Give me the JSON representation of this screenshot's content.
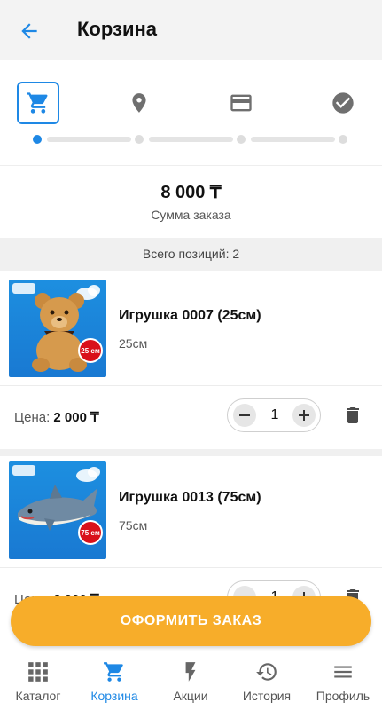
{
  "header": {
    "title": "Корзина"
  },
  "steps": [
    "cart-icon",
    "location-pin-icon",
    "credit-card-icon",
    "check-circle-icon"
  ],
  "total": {
    "amount": "8 000 ₸",
    "caption": "Сумма заказа"
  },
  "count_label": "Всего позиций: 2",
  "items": [
    {
      "name": "Игрушка 0007 (25см)",
      "size": "25см",
      "badge": "25 см",
      "price_label": "Цена:",
      "price": "2 000 ₸",
      "quantity": "1"
    },
    {
      "name": "Игрушка 0013 (75см)",
      "size": "75см",
      "badge": "75 см",
      "price_label": "Цена:",
      "price": "2 000 ₸",
      "quantity": "1"
    }
  ],
  "checkout_label": "ОФОРМИТЬ ЗАКАЗ",
  "nav": [
    {
      "label": "Каталог",
      "icon": "grid-icon"
    },
    {
      "label": "Корзина",
      "icon": "cart-icon",
      "active": true
    },
    {
      "label": "Акции",
      "icon": "lightning-icon"
    },
    {
      "label": "История",
      "icon": "history-icon"
    },
    {
      "label": "Профиль",
      "icon": "menu-icon"
    }
  ],
  "colors": {
    "accent": "#1e88e5",
    "checkout": "#f7ad2a",
    "badge": "#d9101a"
  }
}
